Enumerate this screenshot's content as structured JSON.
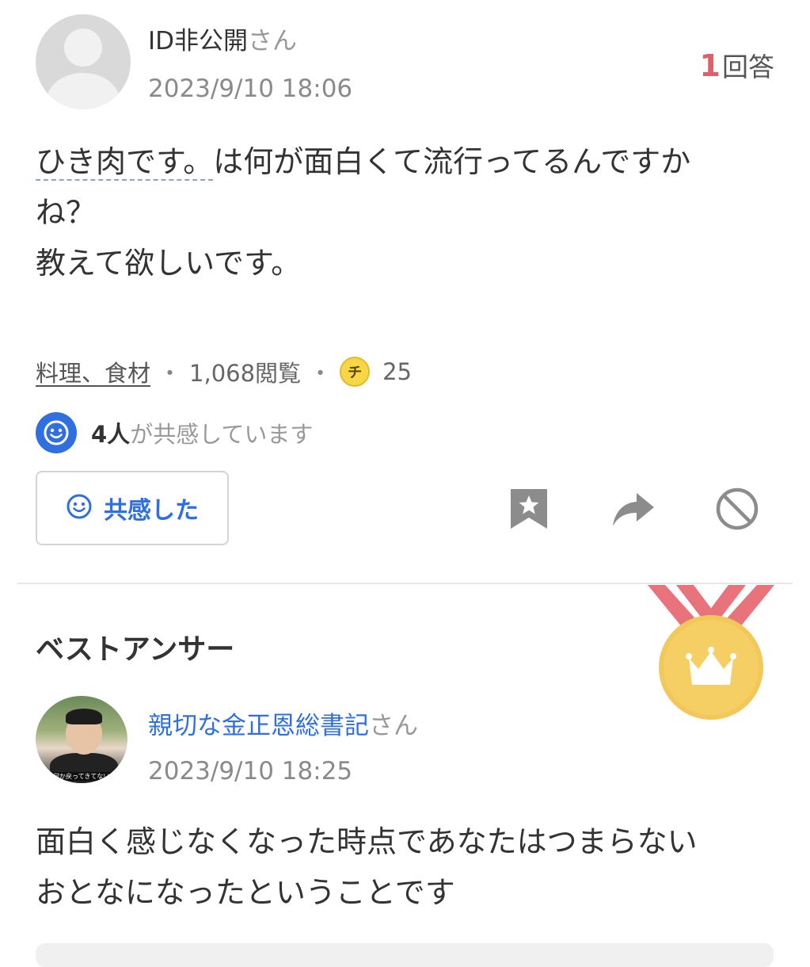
{
  "question": {
    "author": {
      "name": "ID非公開",
      "suffix": "さん"
    },
    "date": "2023/9/10 18:06",
    "answer_count": {
      "number": "1",
      "label": "回答"
    },
    "body": {
      "keyword": "ひき肉です。",
      "line1_rest": "は何が面白くて流行ってるんですか",
      "line2": "ね？",
      "line3": "教えて欲しいです。"
    },
    "meta": {
      "category": "料理、食材",
      "separator": "・",
      "views": "1,068閲覧",
      "coin_glyph": "チ",
      "coins": "25"
    },
    "empathy": {
      "count": "4人",
      "suffix": "が共感しています",
      "button_label": "共感した"
    },
    "actions": {
      "bookmark_icon": "bookmark-star-icon",
      "share_icon": "share-arrow-icon",
      "block_icon": "block-icon"
    }
  },
  "best_answer": {
    "title": "ベストアンサー",
    "medal_icon": "gold-medal-crown-icon",
    "author": {
      "name": "親切な金正恩総書記",
      "suffix": "さん"
    },
    "avatar_caption": "\"何か戻ってきてない?",
    "date": "2023/9/10 18:25",
    "body": {
      "line1": "面白く感じなくなった時点であなたはつまらない",
      "line2": "おとなになったということです"
    }
  },
  "colors": {
    "accent_blue": "#2f6fe0",
    "answer_count_red": "#e0606a",
    "medal_ribbon": "#e8737a",
    "medal_gold": "#f2c85a",
    "coin_yellow": "#f7d748"
  }
}
